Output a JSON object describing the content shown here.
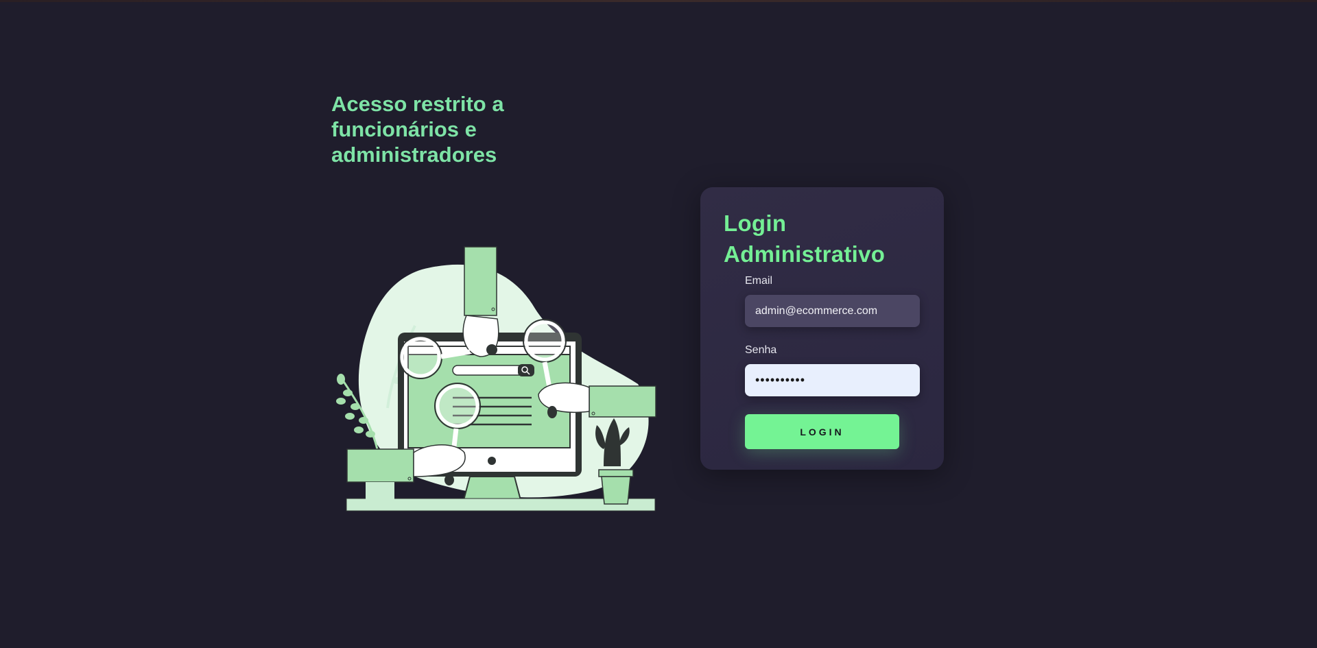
{
  "hero": {
    "headline": "Acesso restrito a funcionários e administradores"
  },
  "login_card": {
    "title": "Login Administrativo",
    "email_label": "Email",
    "email_value": "admin@ecommerce.com",
    "password_label": "Senha",
    "password_value": "••••••••••",
    "button_label": "LOGIN"
  },
  "colors": {
    "background": "#1f1d2c",
    "accent": "#74f394",
    "headline": "#7ee3a6",
    "card": "#2e2a42"
  },
  "illustration": {
    "icon": "web-search-illustration"
  }
}
